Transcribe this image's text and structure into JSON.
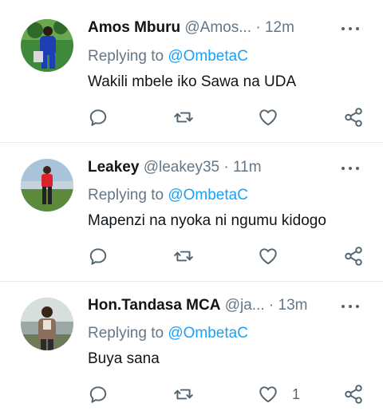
{
  "colors": {
    "accent": "#1da1f2",
    "secondary": "#657786",
    "text": "#0f1419",
    "divider": "#e6ecf0"
  },
  "icons": [
    "reply-icon",
    "retweet-icon",
    "like-icon",
    "share-icon",
    "more-icon"
  ],
  "tweets": [
    {
      "name": "Amos Mburu",
      "handle": "@Amos...",
      "time": "· 12m",
      "replying_label": "Replying to",
      "replying_to": "@OmbetaC",
      "text": "Wakili mbele iko Sawa na UDA",
      "likes": ""
    },
    {
      "name": "Leakey",
      "handle": "@leakey35",
      "time": "· 11m",
      "replying_label": "Replying to",
      "replying_to": "@OmbetaC",
      "text": "Mapenzi na nyoka ni ngumu kidogo",
      "likes": ""
    },
    {
      "name": "Hon.Tandasa MCA",
      "handle": "@ja...",
      "time": "· 13m",
      "replying_label": "Replying to",
      "replying_to": "@OmbetaC",
      "text": "Buya sana",
      "likes": "1"
    }
  ]
}
